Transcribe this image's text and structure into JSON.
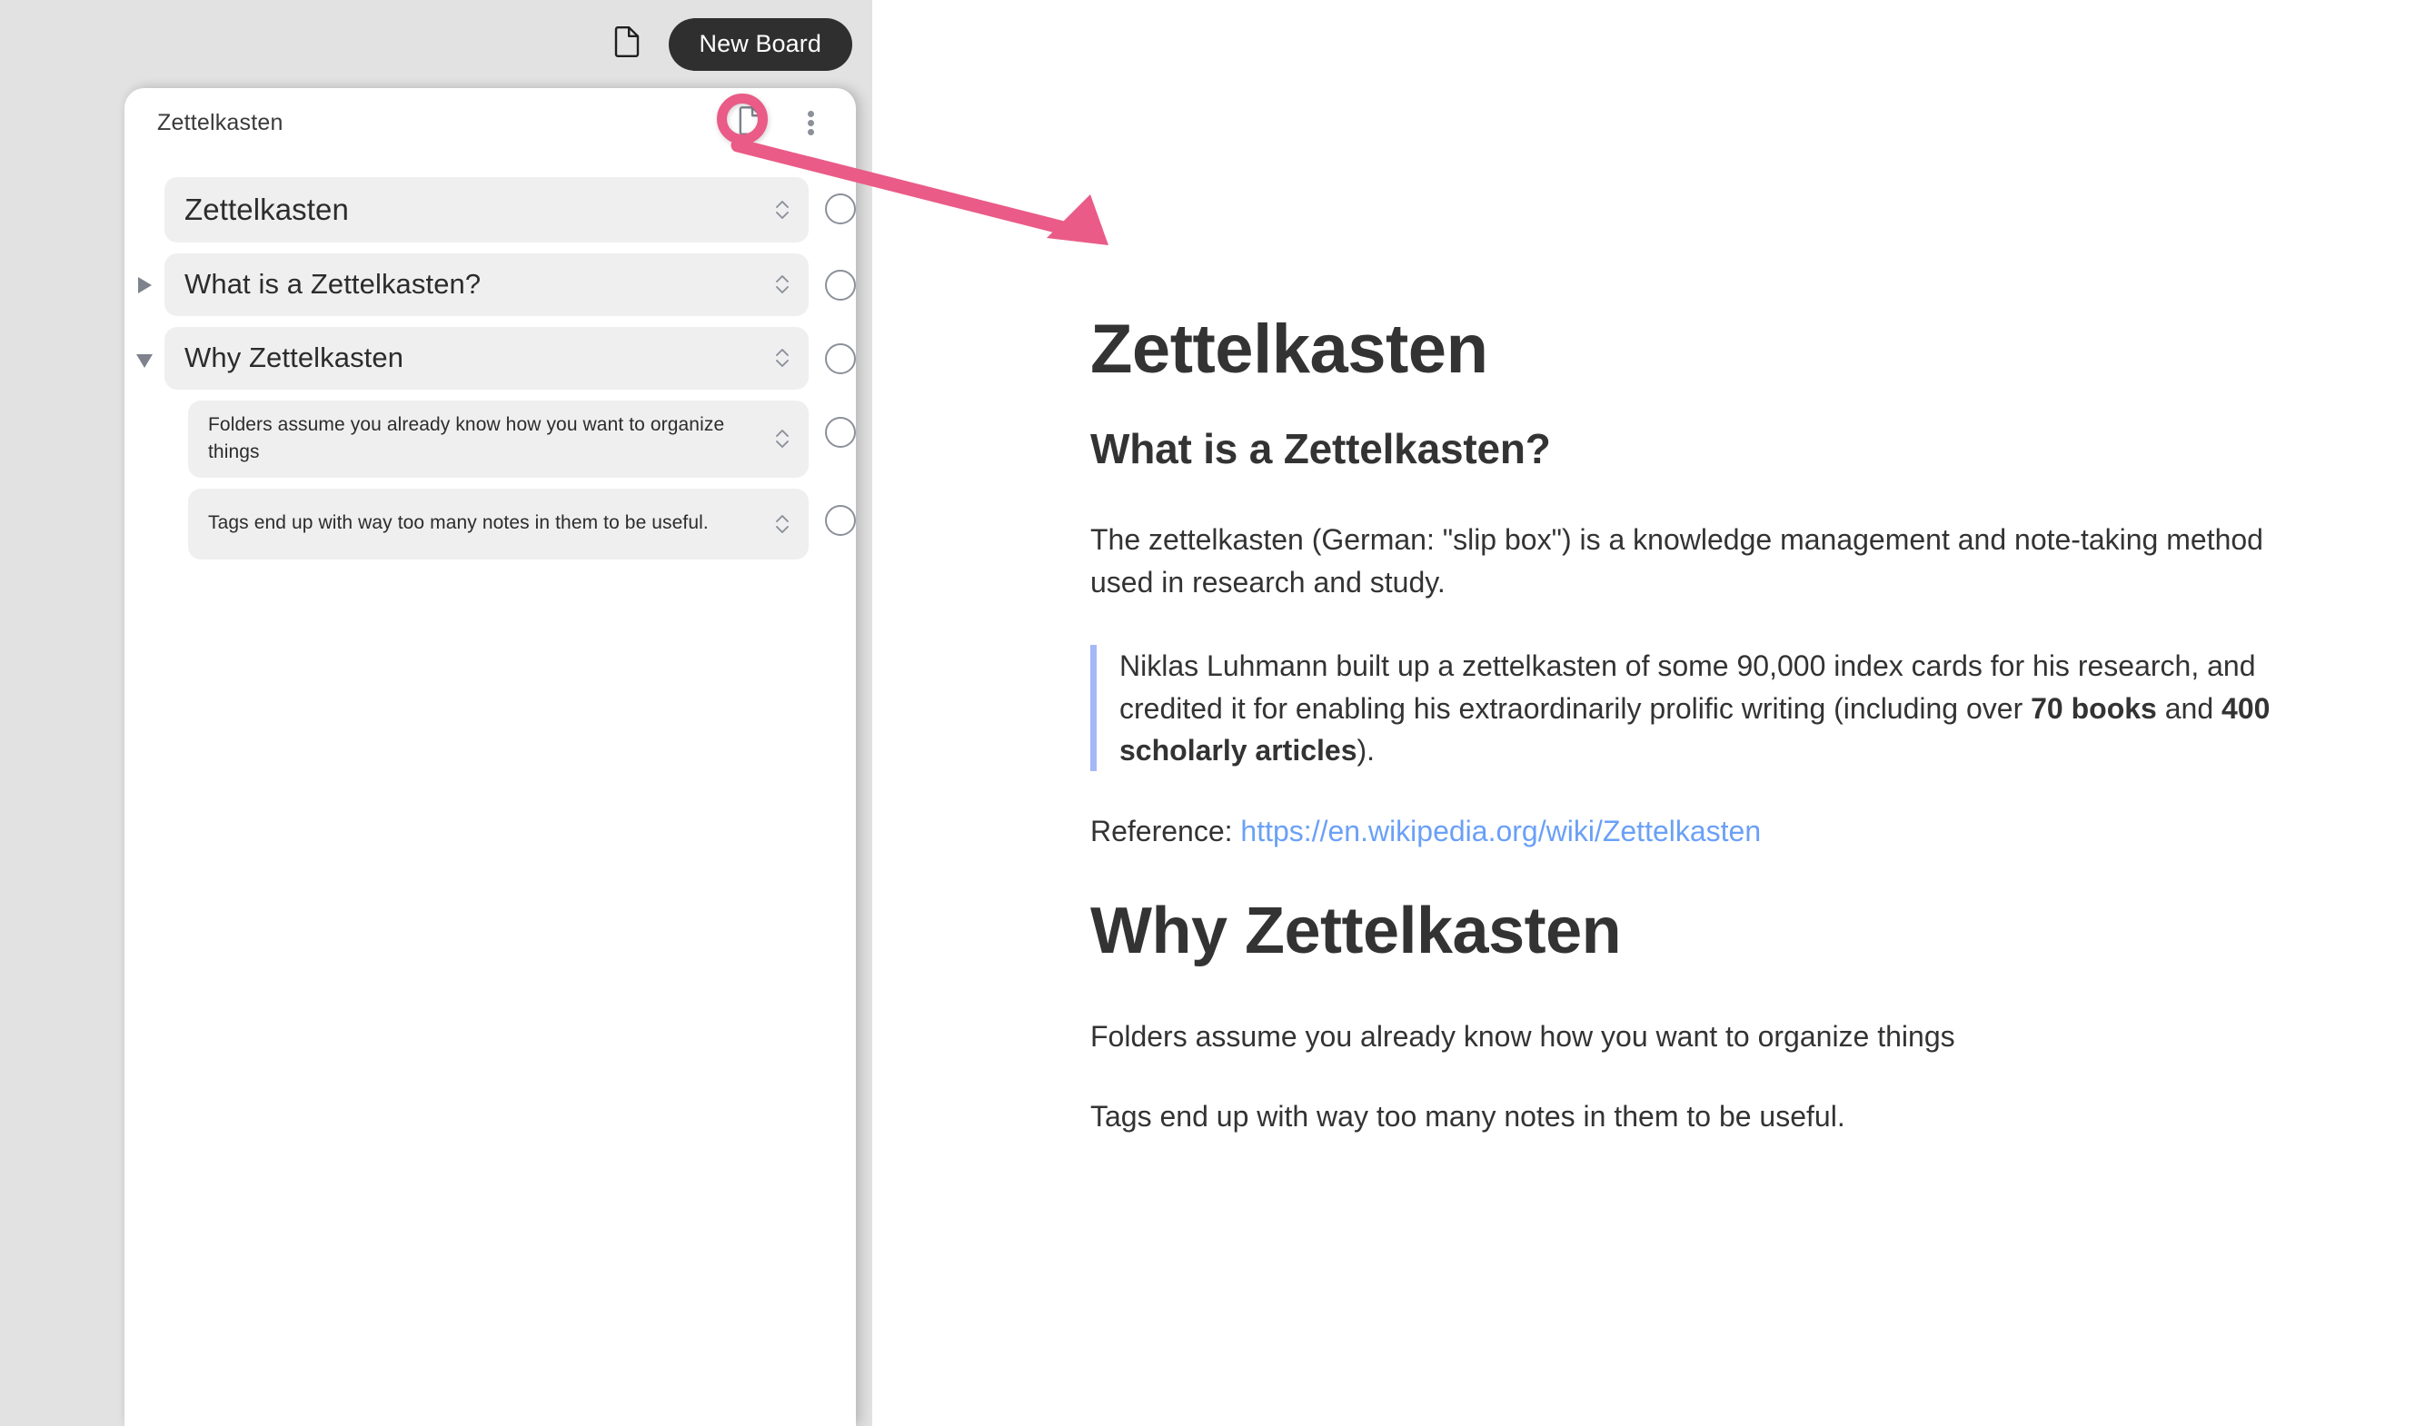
{
  "toolbar": {
    "doc_icon": "document-icon",
    "new_board_label": "New Board"
  },
  "board_panel": {
    "title": "Zettelkasten",
    "header_doc_icon": "document-icon",
    "header_kebab_icon": "more-vertical-icon",
    "outline": [
      {
        "text": "Zettelkasten",
        "level": 0,
        "twisty": "none",
        "stepper_icon": "chevron-up-down-icon",
        "bullet": "circle-outline"
      },
      {
        "text": "What is a Zettelkasten?",
        "level": 1,
        "twisty": "right",
        "stepper_icon": "chevron-up-down-icon",
        "bullet": "circle-outline"
      },
      {
        "text": "Why Zettelkasten",
        "level": 1,
        "twisty": "down",
        "stepper_icon": "chevron-up-down-icon",
        "bullet": "circle-outline"
      },
      {
        "text": "Folders assume you already know how you want to organize things",
        "level": 2,
        "twisty": "none",
        "stepper_icon": "chevron-up-down-icon",
        "bullet": "circle-outline"
      },
      {
        "text": "Tags end up with way too many notes in them to be useful.",
        "level": 2,
        "twisty": "none",
        "stepper_icon": "chevron-up-down-icon",
        "bullet": "circle-outline"
      }
    ]
  },
  "annotation": {
    "highlight_color": "#ea5b87",
    "circle_target": "document-icon",
    "arrow_points_to": "document-title"
  },
  "document": {
    "title": "Zettelkasten",
    "section_heading": "What is a Zettelkasten?",
    "paragraph_1": "The zettelkasten (German: \"slip box\") is a knowledge management and note-taking method used in research and study.",
    "quote": {
      "part_1": "Niklas Luhmann built up a zettelkasten of some 90,000 index cards for his research, and credited it for enabling his extraordinarily prolific writing (including over ",
      "bold_1": "70 books",
      "part_2": " and ",
      "bold_2": "400 scholarly articles",
      "part_3": ").",
      "border_color": "#a3b8f5"
    },
    "reference_label": "Reference: ",
    "reference_url": "https://en.wikipedia.org/wiki/Zettelkasten",
    "reference_link_color": "#6aa0f7",
    "heading_2": "Why Zettelkasten",
    "paragraph_2": "Folders assume you already know how you want to organize things",
    "paragraph_3": "Tags end up with way too many notes in them to be useful."
  }
}
